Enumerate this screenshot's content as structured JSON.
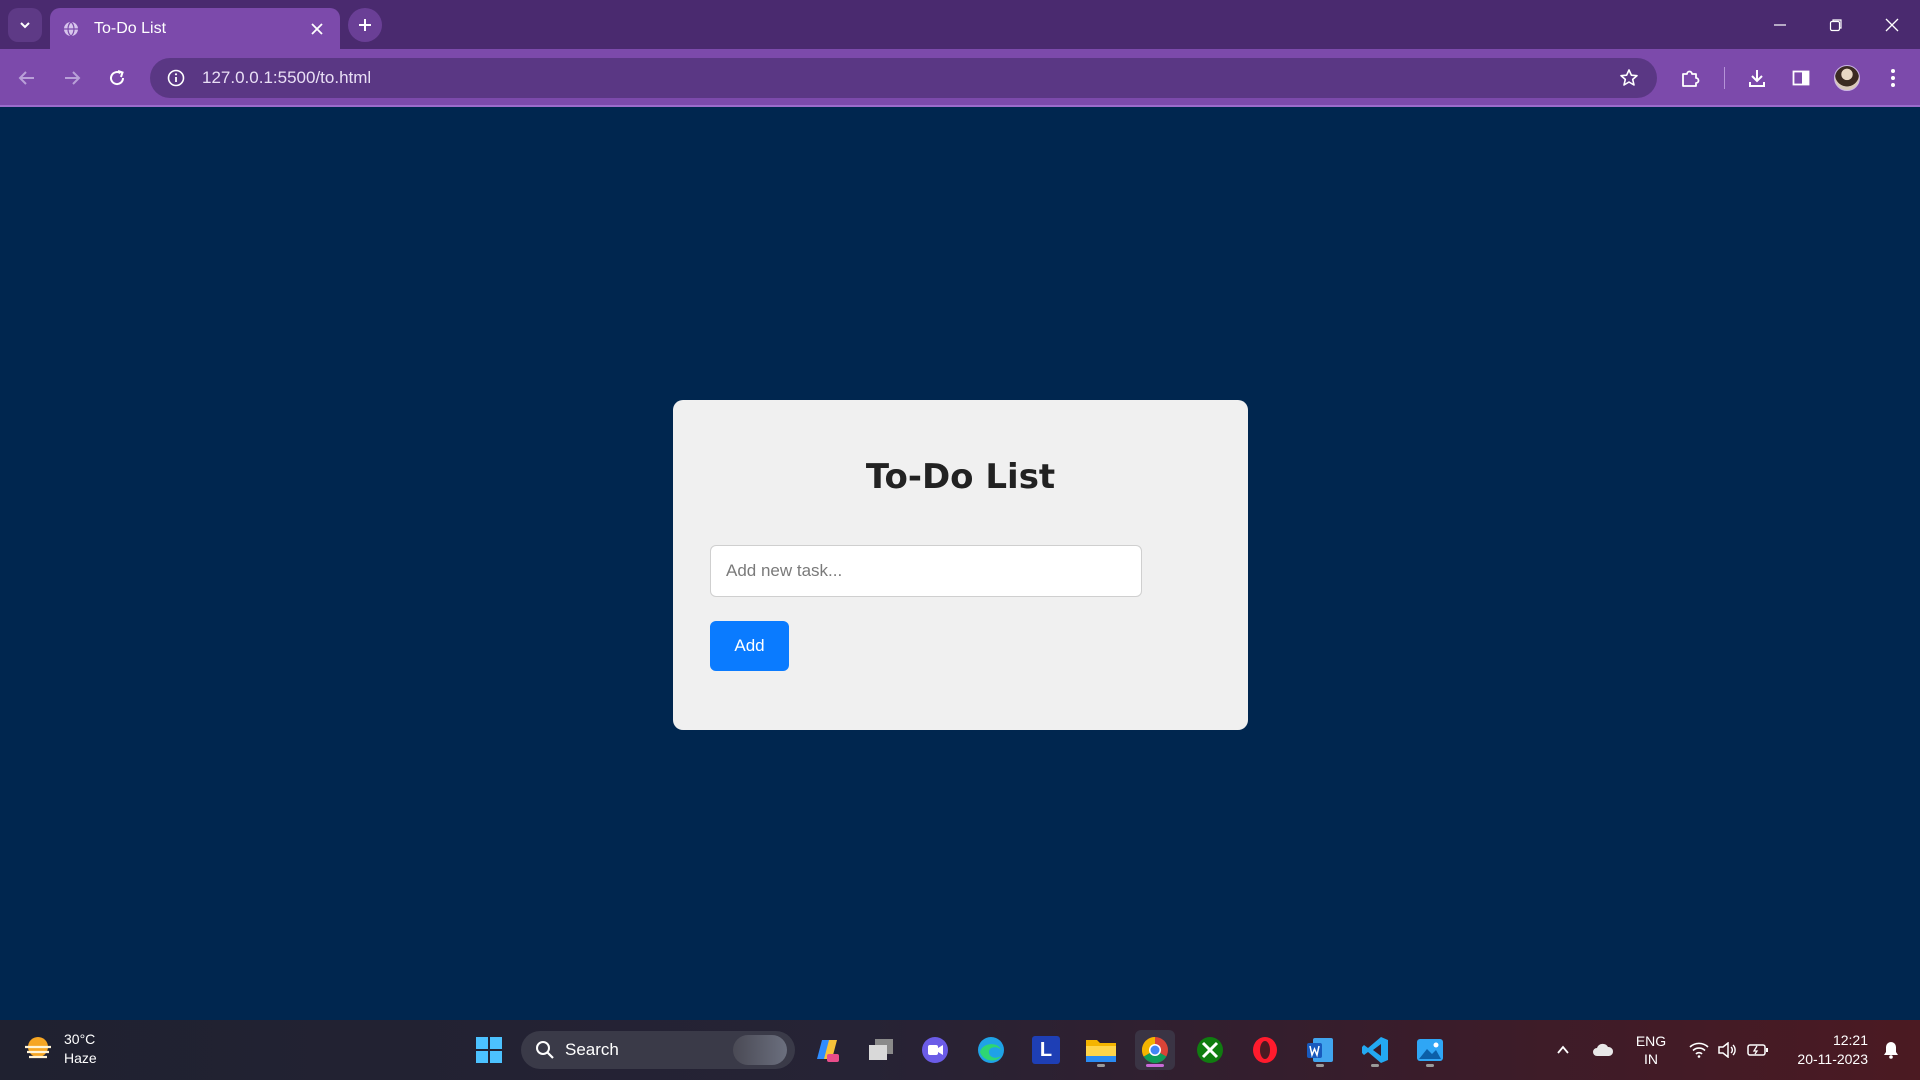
{
  "browser": {
    "tab": {
      "title": "To-Do List"
    },
    "address_bar": {
      "url": "127.0.0.1:5500/to.html"
    }
  },
  "page": {
    "title": "To-Do List",
    "task_input": {
      "value": "",
      "placeholder": "Add new task..."
    },
    "add_button_label": "Add"
  },
  "taskbar": {
    "weather": {
      "temp": "30°C",
      "condition": "Haze"
    },
    "search_label": "Search",
    "apps": [
      "start-icon",
      "search",
      "copilot-icon",
      "task-view-icon",
      "meet-icon",
      "edge-icon",
      "l-app-icon",
      "file-explorer-icon",
      "chrome-icon",
      "xbox-icon",
      "opera-icon",
      "word-icon",
      "vscode-icon",
      "photos-icon"
    ],
    "tray": {
      "lang_line1": "ENG",
      "lang_line2": "IN",
      "time": "12:21",
      "date": "20-11-2023"
    }
  },
  "colors": {
    "page_background": "#00264f",
    "card_background": "#f0f0f0",
    "accent_button": "#0a7bff",
    "browser_frame": "#7c4aab"
  }
}
